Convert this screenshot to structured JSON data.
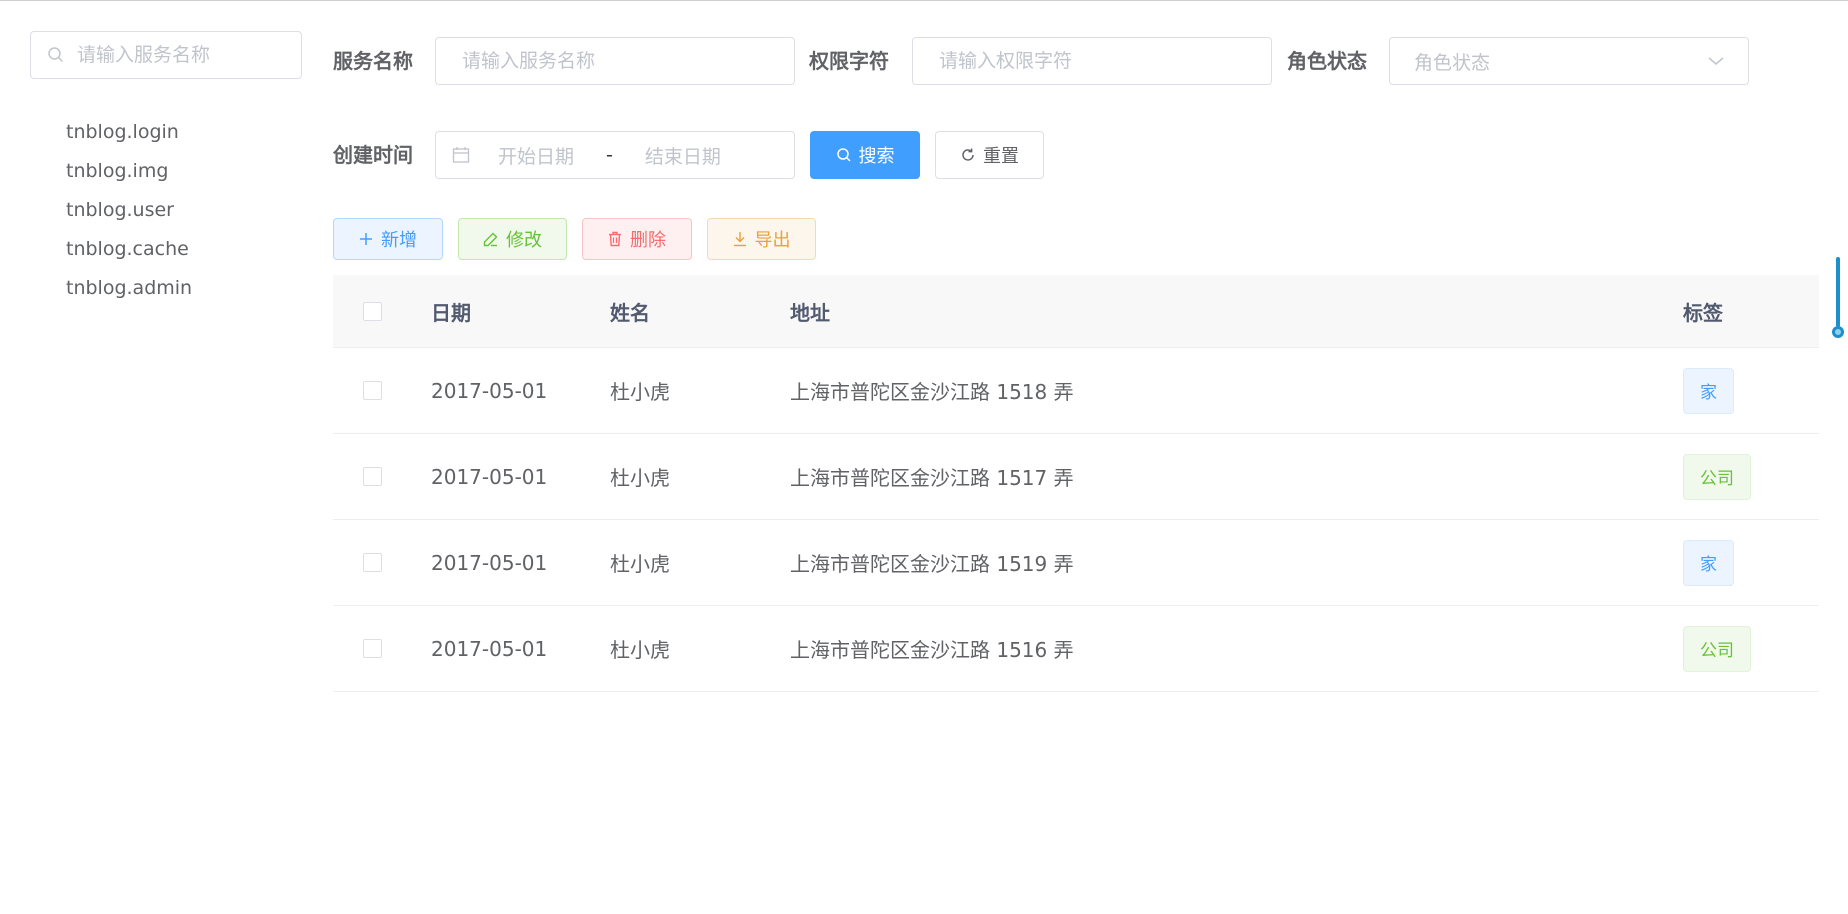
{
  "sidebar": {
    "search_placeholder": "请输入服务名称",
    "items": [
      {
        "label": "tnblog.login"
      },
      {
        "label": "tnblog.img"
      },
      {
        "label": "tnblog.user"
      },
      {
        "label": "tnblog.cache"
      },
      {
        "label": "tnblog.admin"
      }
    ]
  },
  "filters": {
    "service_name": {
      "label": "服务名称",
      "placeholder": "请输入服务名称",
      "value": ""
    },
    "permission": {
      "label": "权限字符",
      "placeholder": "请输入权限字符",
      "value": ""
    },
    "role_status": {
      "label": "角色状态",
      "placeholder": "角色状态"
    },
    "created_time": {
      "label": "创建时间",
      "start_placeholder": "开始日期",
      "separator": "-",
      "end_placeholder": "结束日期"
    },
    "search_label": "搜索",
    "reset_label": "重置"
  },
  "toolbar": {
    "add_label": "新增",
    "edit_label": "修改",
    "delete_label": "删除",
    "export_label": "导出"
  },
  "table": {
    "columns": {
      "date": "日期",
      "name": "姓名",
      "address": "地址",
      "tag": "标签"
    },
    "rows": [
      {
        "date": "2017-05-01",
        "name": "杜小虎",
        "address": "上海市普陀区金沙江路 1518 弄",
        "tag": "家"
      },
      {
        "date": "2017-05-01",
        "name": "杜小虎",
        "address": "上海市普陀区金沙江路 1517 弄",
        "tag": "公司"
      },
      {
        "date": "2017-05-01",
        "name": "杜小虎",
        "address": "上海市普陀区金沙江路 1519 弄",
        "tag": "家"
      },
      {
        "date": "2017-05-01",
        "name": "杜小虎",
        "address": "上海市普陀区金沙江路 1516 弄",
        "tag": "公司"
      }
    ]
  },
  "colors": {
    "primary": "#409eff",
    "success": "#67c23a",
    "danger": "#f56c6c",
    "warning": "#e6a23c",
    "scroll_indicator": "#1d8fc9"
  },
  "icons": {
    "sidebar_search": "search-icon",
    "select_arrow": "chevron-down-icon",
    "date": "calendar-icon",
    "search_button": "search-icon",
    "reset_button": "refresh-icon",
    "add": "plus-icon",
    "edit": "edit-icon",
    "delete": "trash-icon",
    "export": "download-icon"
  }
}
